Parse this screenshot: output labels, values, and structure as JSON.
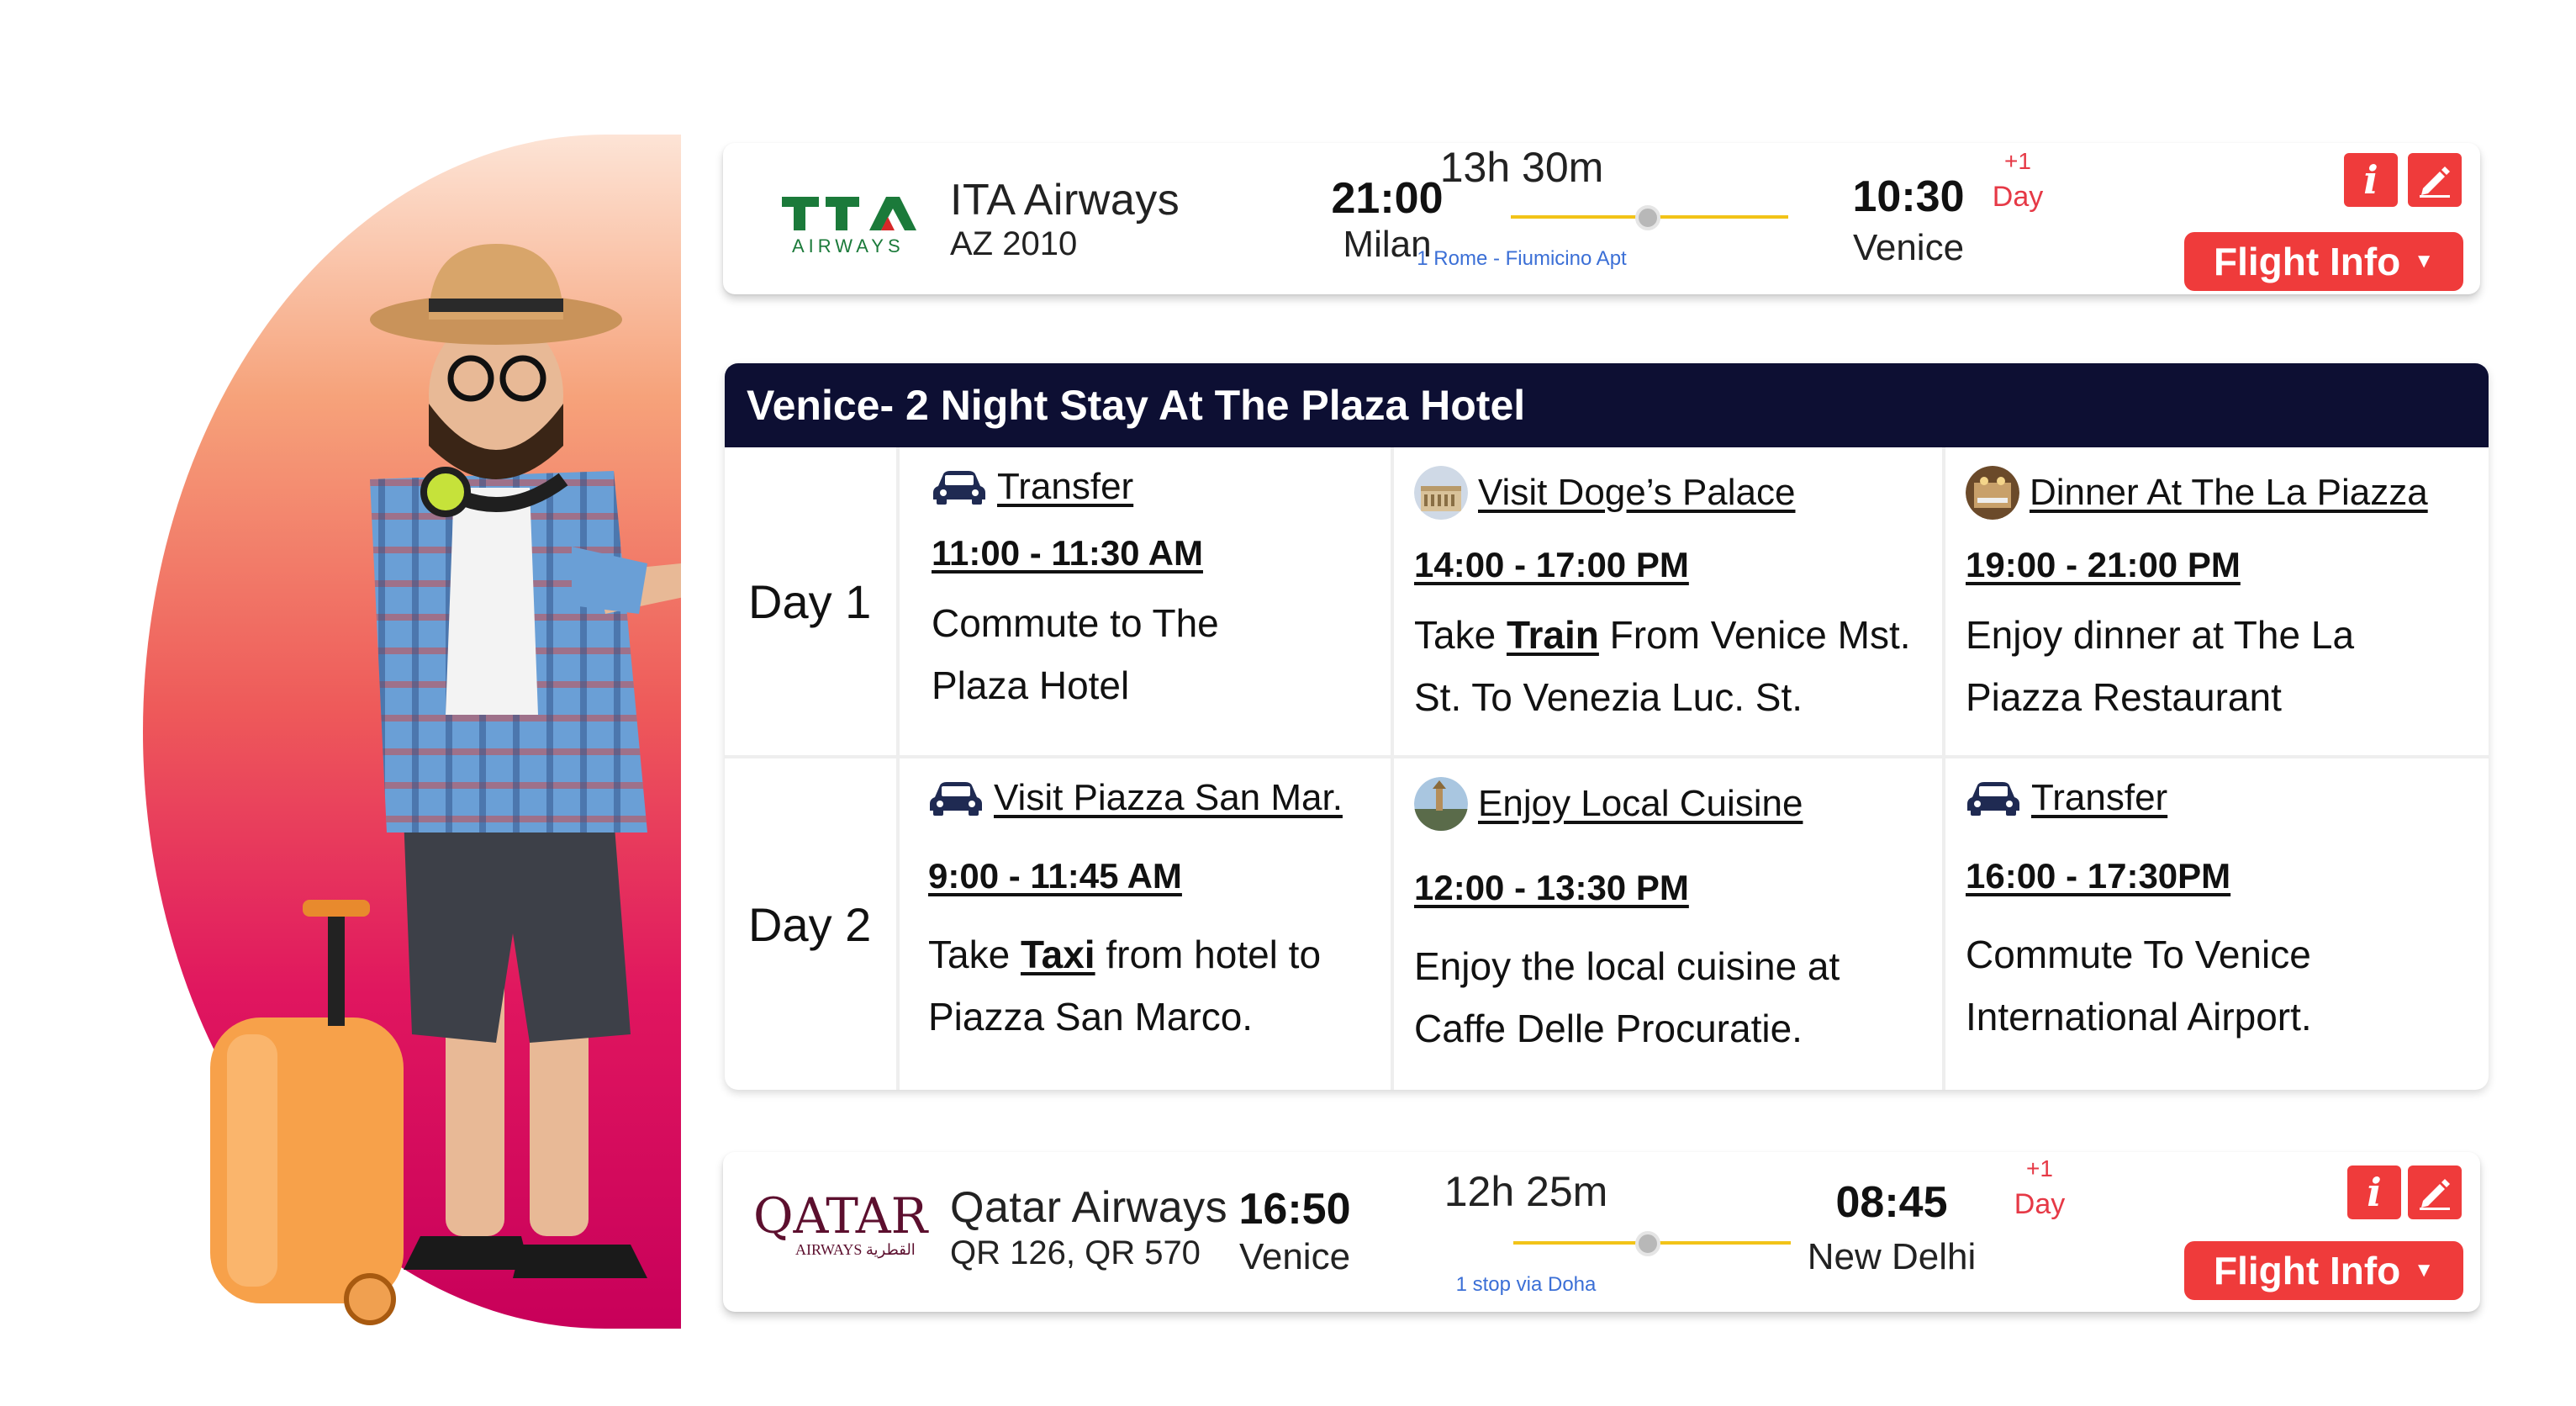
{
  "flights": [
    {
      "airline": "ITA Airways",
      "flight_number": "AZ 2010",
      "logo_text": "ITA",
      "logo_sub": "AIRWAYS",
      "depart_time": "21:00",
      "depart_city": "Milan",
      "duration": "13h 30m",
      "route_note": "1 Rome - Fiumicino Apt",
      "arrive_time": "10:30",
      "arrive_city": "Venice",
      "plus": "+1",
      "plus_day": "Day",
      "info_label": "Flight Info"
    },
    {
      "airline": "Qatar Airways",
      "flight_number": "QR 126, QR 570",
      "logo_text": "QATAR",
      "logo_sub": "AIRWAYS القطرية",
      "depart_time": "16:50",
      "depart_city": "Venice",
      "duration": "12h 25m",
      "route_note": "1 stop via Doha",
      "arrive_time": "08:45",
      "arrive_city": "New Delhi",
      "plus": "+1",
      "plus_day": "Day",
      "info_label": "Flight Info"
    }
  ],
  "itinerary": {
    "title": "Venice- 2 Night Stay At The Plaza Hotel",
    "days": [
      {
        "label": "Day 1",
        "activities": [
          {
            "icon": "car-icon",
            "title": "Transfer",
            "time": "11:00 - 11:30 AM",
            "desc_pre": "Commute to The Plaza Hotel",
            "desc_bold": "",
            "desc_post": ""
          },
          {
            "icon": "palace-thumb",
            "title": "Visit Doge’s Palace",
            "time": "14:00 - 17:00 PM",
            "desc_pre": "Take ",
            "desc_bold": "Train",
            "desc_post": " From Venice Mst. St. To Venezia Luc. St."
          },
          {
            "icon": "restaurant-thumb",
            "title": "Dinner At The La Piazza",
            "time": "19:00 - 21:00 PM",
            "desc_pre": "Enjoy dinner at The La Piazza Restaurant",
            "desc_bold": "",
            "desc_post": ""
          }
        ]
      },
      {
        "label": "Day 2",
        "activities": [
          {
            "icon": "car-icon",
            "title": "Visit Piazza San Mar.",
            "time": "9:00 - 11:45 AM",
            "desc_pre": "Take ",
            "desc_bold": "Taxi",
            "desc_post": " from hotel to Piazza San Marco."
          },
          {
            "icon": "cuisine-thumb",
            "title": "Enjoy Local Cuisine",
            "time": "12:00 - 13:30 PM",
            "desc_pre": "Enjoy the local cuisine at Caffe Delle Procuratie.",
            "desc_bold": "",
            "desc_post": ""
          },
          {
            "icon": "car-icon",
            "title": "Transfer",
            "time": "16:00 - 17:30PM",
            "desc_pre": "Commute To Venice International Airport.",
            "desc_bold": "",
            "desc_post": ""
          }
        ]
      }
    ]
  },
  "colors": {
    "accent_red": "#ef3b3b",
    "header_navy": "#0d0f33",
    "route_yellow": "#f2c318",
    "note_blue": "#3b6fd6"
  }
}
